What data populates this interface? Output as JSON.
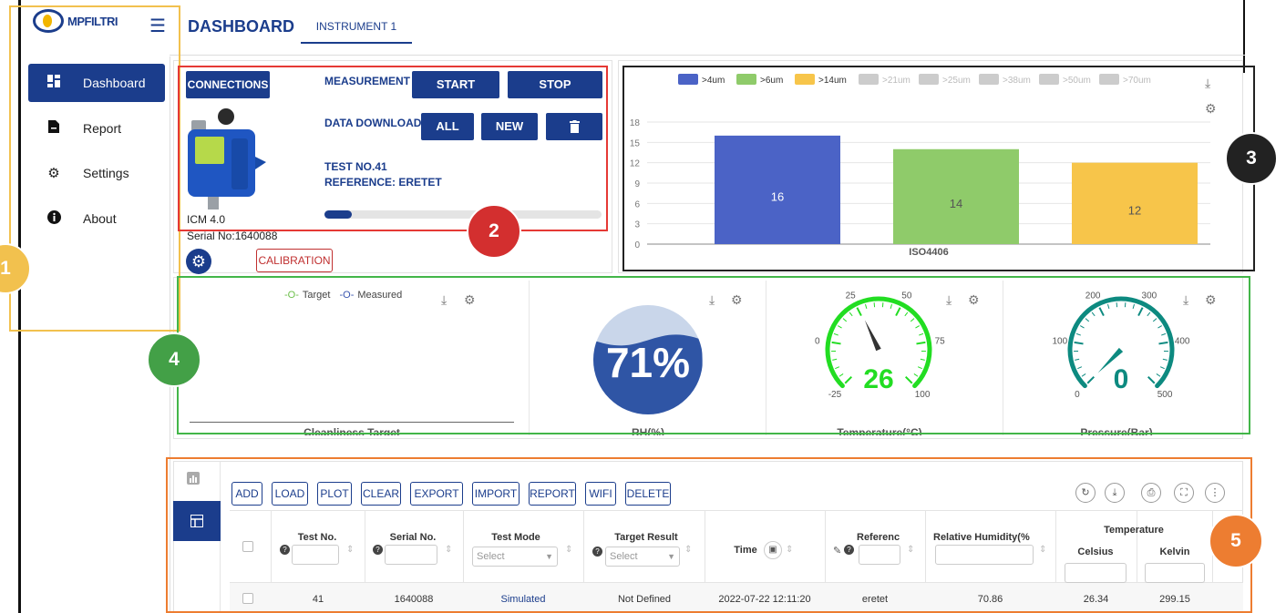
{
  "header": {
    "logo_text": "MPFILTRI",
    "title": "DASHBOARD",
    "tab": "INSTRUMENT 1"
  },
  "sidebar": {
    "items": [
      {
        "label": "Dashboard",
        "icon": "grid-icon",
        "active": true
      },
      {
        "label": "Report",
        "icon": "file-icon",
        "active": false
      },
      {
        "label": "Settings",
        "icon": "gear-icon",
        "active": false
      },
      {
        "label": "About",
        "icon": "info-icon",
        "active": false
      }
    ]
  },
  "instrument": {
    "connections_label": "CONNECTIONS",
    "measurement_label": "MEASUREMENT",
    "start_label": "START",
    "stop_label": "STOP",
    "data_download_label": "DATA DOWNLOAD",
    "all_label": "ALL",
    "new_label": "NEW",
    "test_no": "TEST NO.41",
    "reference": "REFERENCE: ERETET",
    "model": "ICM 4.0",
    "serial": "Serial No:1640088",
    "calibration_label": "CALIBRATION",
    "progress": 0.1
  },
  "annotations": {
    "n1": "1",
    "n2": "2",
    "n3": "3",
    "n4": "4",
    "n5": "5"
  },
  "chart_data": {
    "type": "bar",
    "categories": [
      ">4um",
      ">6um",
      ">14um"
    ],
    "values": [
      16,
      14,
      12
    ],
    "colors": [
      "#4b63c6",
      "#8fcb6a",
      "#f7c54a"
    ],
    "legend": [
      {
        "name": ">4um",
        "color": "#4b63c6",
        "active": true
      },
      {
        "name": ">6um",
        "color": "#8fcb6a",
        "active": true
      },
      {
        "name": ">14um",
        "color": "#f7c54a",
        "active": true
      },
      {
        "name": ">21um",
        "color": "#cccccc",
        "active": false
      },
      {
        "name": ">25um",
        "color": "#cccccc",
        "active": false
      },
      {
        "name": ">38um",
        "color": "#cccccc",
        "active": false
      },
      {
        "name": ">50um",
        "color": "#cccccc",
        "active": false
      },
      {
        "name": ">70um",
        "color": "#cccccc",
        "active": false
      }
    ],
    "xlabel": "ISO4406",
    "yticks": [
      0,
      3,
      6,
      9,
      12,
      15,
      18
    ],
    "ylim": [
      0,
      18
    ],
    "grid": true
  },
  "gauges": {
    "cleanliness": {
      "legend_target": "Target",
      "legend_measured": "Measured",
      "label": "Cleanliness Target"
    },
    "humidity": {
      "value": 71,
      "text": "71%",
      "label": "RH(%)"
    },
    "temperature": {
      "value": 26,
      "text": "26",
      "min": -25,
      "max": 100,
      "ticks": [
        "-25",
        "0",
        "25",
        "50",
        "75",
        "100"
      ],
      "label": "Temperature(°C)",
      "color": "#22dd22"
    },
    "pressure": {
      "value": 0,
      "text": "0",
      "min": 0,
      "max": 500,
      "ticks": [
        "0",
        "100",
        "200",
        "300",
        "400",
        "500"
      ],
      "label": "Pressure(Bar)",
      "color": "#0d8a80"
    }
  },
  "table": {
    "buttons": [
      "ADD",
      "LOAD",
      "PLOT",
      "CLEAR",
      "EXPORT",
      "IMPORT",
      "REPORT",
      "WIFI",
      "DELETE"
    ],
    "columns": {
      "test_no": "Test No.",
      "serial_no": "Serial No.",
      "test_mode": "Test Mode",
      "target_result": "Target Result",
      "time": "Time",
      "reference": "Referenc",
      "rh": "Relative Humidity(%",
      "temperature": "Temperature",
      "celsius": "Celsius",
      "kelvin": "Kelvin"
    },
    "select_placeholder": "Select",
    "row": {
      "test_no": "41",
      "serial_no": "1640088",
      "test_mode": "Simulated",
      "target_result": "Not Defined",
      "time": "2022-07-22 12:11:20",
      "reference": "eretet",
      "rh": "70.86",
      "celsius": "26.34",
      "kelvin": "299.15"
    }
  }
}
